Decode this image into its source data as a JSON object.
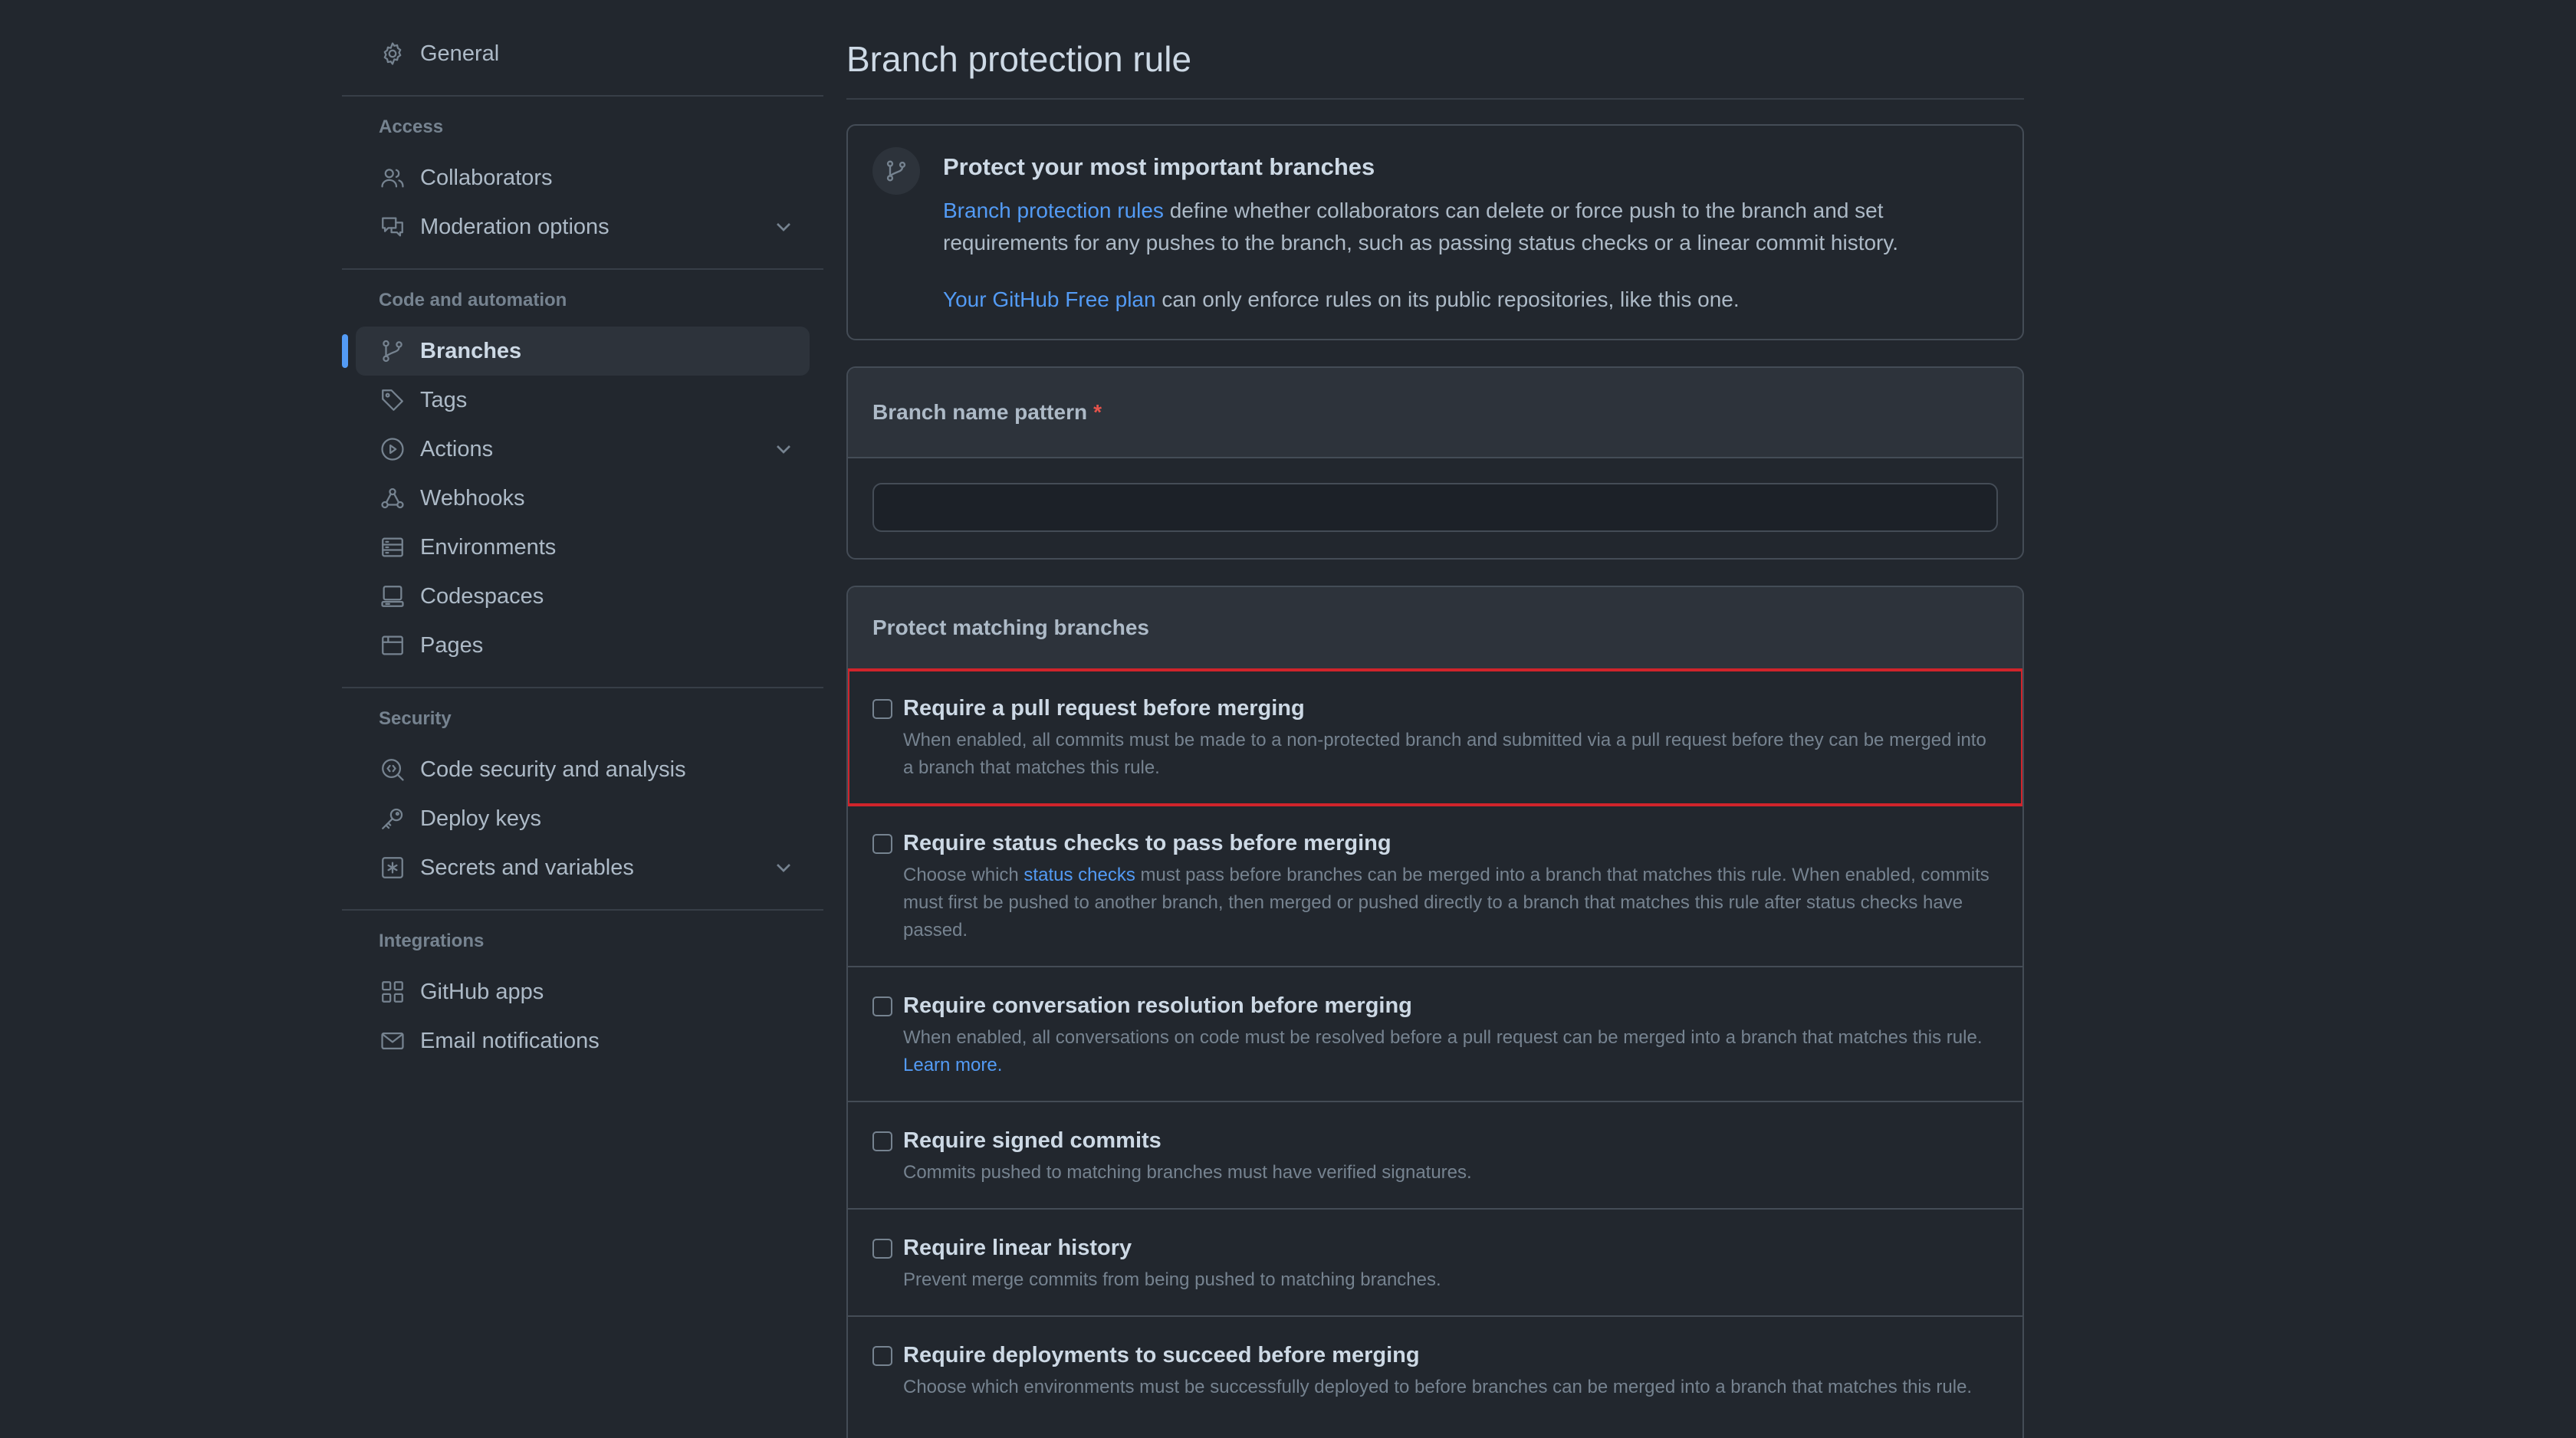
{
  "sidebar": {
    "general": "General",
    "sections": {
      "access": {
        "heading": "Access",
        "items": [
          "Collaborators",
          "Moderation options"
        ]
      },
      "code": {
        "heading": "Code and automation",
        "items": [
          "Branches",
          "Tags",
          "Actions",
          "Webhooks",
          "Environments",
          "Codespaces",
          "Pages"
        ]
      },
      "security": {
        "heading": "Security",
        "items": [
          "Code security and analysis",
          "Deploy keys",
          "Secrets and variables"
        ]
      },
      "integrations": {
        "heading": "Integrations",
        "items": [
          "GitHub apps",
          "Email notifications"
        ]
      }
    },
    "active_item": "Branches"
  },
  "main": {
    "title": "Branch protection rule",
    "intro": {
      "heading": "Protect your most important branches",
      "p1_link": "Branch protection rules",
      "p1_text": " define whether collaborators can delete or force push to the branch and set requirements for any pushes to the branch, such as passing status checks or a linear commit history.",
      "p2_link": "Your GitHub Free plan",
      "p2_text": " can only enforce rules on its public repositories, like this one."
    },
    "pattern": {
      "label": "Branch name pattern",
      "required_mark": "*",
      "value": ""
    },
    "protect": {
      "heading": "Protect matching branches",
      "options": [
        {
          "title": "Require a pull request before merging",
          "desc": "When enabled, all commits must be made to a non-protected branch and submitted via a pull request before they can be merged into a branch that matches this rule.",
          "checked": false
        },
        {
          "title": "Require status checks to pass before merging",
          "desc_a": "Choose which ",
          "desc_link": "status checks",
          "desc_b": " must pass before branches can be merged into a branch that matches this rule. When enabled, commits must first be pushed to another branch, then merged or pushed directly to a branch that matches this rule after status checks have passed.",
          "checked": false
        },
        {
          "title": "Require conversation resolution before merging",
          "desc": "When enabled, all conversations on code must be resolved before a pull request can be merged into a branch that matches this rule. ",
          "desc_link": "Learn more.",
          "checked": false
        },
        {
          "title": "Require signed commits",
          "desc": "Commits pushed to matching branches must have verified signatures.",
          "checked": false
        },
        {
          "title": "Require linear history",
          "desc": "Prevent merge commits from being pushed to matching branches.",
          "checked": false
        },
        {
          "title": "Require deployments to succeed before merging",
          "desc": "Choose which environments must be successfully deployed to before branches can be merged into a branch that matches this rule.",
          "checked": false
        }
      ]
    }
  },
  "colors": {
    "background": "#22272e",
    "accent": "#539bf5",
    "highlight_border": "#d0242b",
    "required": "#e5534b"
  }
}
